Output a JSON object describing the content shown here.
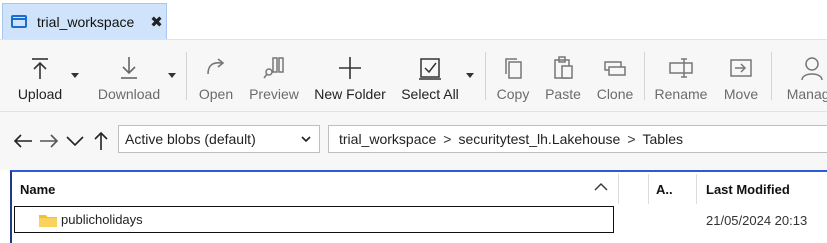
{
  "tab": {
    "title": "trial_workspace",
    "close_glyph": "✖"
  },
  "ribbon": {
    "buttons": [
      {
        "label": "Upload",
        "icon": "upload-icon"
      },
      {
        "label": "Download",
        "icon": "download-icon"
      },
      {
        "label": "Open",
        "icon": "open-icon"
      },
      {
        "label": "Preview",
        "icon": "preview-icon"
      },
      {
        "label": "New Folder",
        "icon": "plus-icon"
      },
      {
        "label": "Select All",
        "icon": "select-all-icon"
      },
      {
        "label": "Copy",
        "icon": "copy-icon"
      },
      {
        "label": "Paste",
        "icon": "paste-icon"
      },
      {
        "label": "Clone",
        "icon": "clone-icon"
      },
      {
        "label": "Rename",
        "icon": "rename-icon"
      },
      {
        "label": "Move",
        "icon": "move-icon"
      },
      {
        "label": "Manage",
        "icon": "manage-icon"
      }
    ]
  },
  "nav": {
    "filter_value": "Active blobs (default)",
    "breadcrumb": [
      "trial_workspace",
      "securitytest_lh.Lakehouse",
      "Tables"
    ]
  },
  "table": {
    "columns": [
      "Name",
      "A..",
      "Last Modified"
    ],
    "rows": [
      {
        "name": "publicholidays",
        "modified": "21/05/2024 20:13"
      }
    ]
  }
}
